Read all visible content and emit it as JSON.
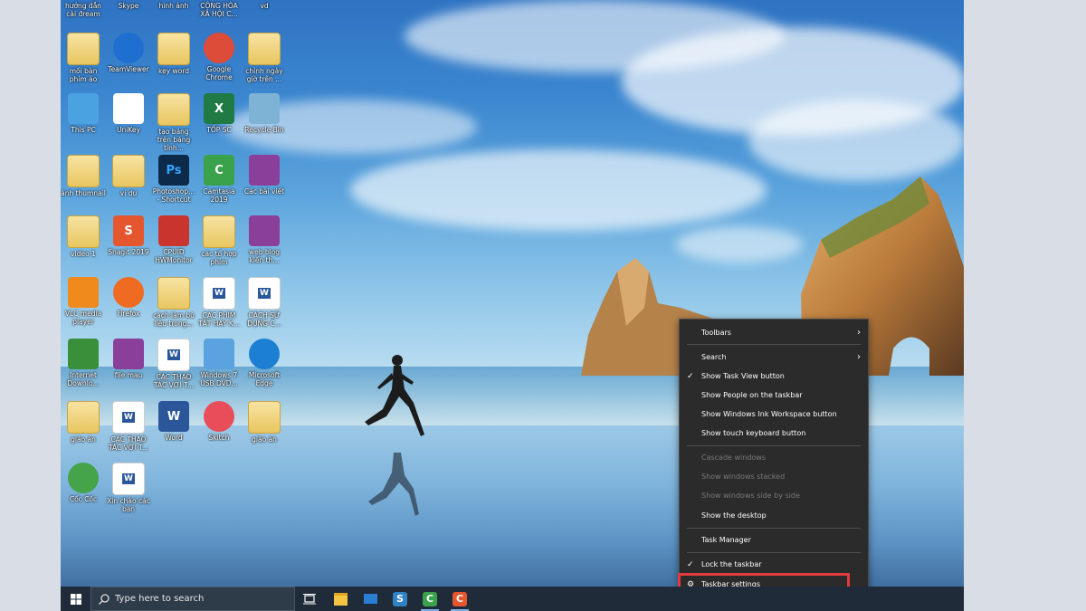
{
  "desktop": {
    "top_labels": [
      "hướng dẫn cài đream",
      "Skype",
      "hình ảnh",
      "CỘNG HÒA XÃ HỘI C...",
      "vd"
    ],
    "icons": [
      {
        "label": "mối bàn phím ảo",
        "icon": "folder-icon"
      },
      {
        "label": "TeamViewer",
        "icon": "teamviewer-icon"
      },
      {
        "label": "key word",
        "icon": "folder-icon"
      },
      {
        "label": "Google Chrome",
        "icon": "chrome-icon"
      },
      {
        "label": "chỉnh ngày giờ trên ...",
        "icon": "folder-icon"
      },
      {
        "label": "This PC",
        "icon": "computer-icon"
      },
      {
        "label": "UniKey",
        "icon": "unikey-icon"
      },
      {
        "label": "tạo bảng trên bảng tính...",
        "icon": "folder-icon"
      },
      {
        "label": "TỐP SC",
        "icon": "excel-icon"
      },
      {
        "label": "Recycle Bin",
        "icon": "recycle-bin-icon"
      },
      {
        "label": "ảnh thumnail",
        "icon": "folder-icon"
      },
      {
        "label": "ví dụ",
        "icon": "folder-icon"
      },
      {
        "label": "Photoshop... - Shortcut",
        "icon": "photoshop-icon"
      },
      {
        "label": "Camtasia 2019",
        "icon": "camtasia-icon"
      },
      {
        "label": "Các bài viết",
        "icon": "winrar-icon"
      },
      {
        "label": "video 1",
        "icon": "folder-icon"
      },
      {
        "label": "Snagit 2019",
        "icon": "snagit-icon"
      },
      {
        "label": "CPUID HWMonitor",
        "icon": "hwmonitor-icon"
      },
      {
        "label": "các tổ hợp phím",
        "icon": "folder-icon"
      },
      {
        "label": "web blog kiến th...",
        "icon": "winrar-icon"
      },
      {
        "label": "VLC media player",
        "icon": "vlc-icon"
      },
      {
        "label": "Firefox",
        "icon": "firefox-icon"
      },
      {
        "label": "cách làm bù liệu trong...",
        "icon": "folder-icon"
      },
      {
        "label": "CÁC PHÍM TẮT HAY K...",
        "icon": "word-icon"
      },
      {
        "label": "CÁCH SỬ DỤNG C...",
        "icon": "word-icon"
      },
      {
        "label": "Internet Downlo...",
        "icon": "idm-icon"
      },
      {
        "label": "file mau",
        "icon": "winrar-icon"
      },
      {
        "label": "CÁC THAO TÁC VỚI T...",
        "icon": "word-icon"
      },
      {
        "label": "Windows 7 USB DVD...",
        "icon": "windows-usb-icon"
      },
      {
        "label": "Microsoft Edge",
        "icon": "edge-icon"
      },
      {
        "label": "giáo án",
        "icon": "folder-icon"
      },
      {
        "label": "CÁC THAO TÁC VỚI T...",
        "icon": "word-icon"
      },
      {
        "label": "Word",
        "icon": "word-app-icon"
      },
      {
        "label": "Skitch",
        "icon": "skitch-icon"
      },
      {
        "label": "giáo án",
        "icon": "folder-icon"
      },
      {
        "label": "Cốc Cốc",
        "icon": "coccoc-icon"
      },
      {
        "label": "Xin chào các bạn",
        "icon": "word-icon"
      }
    ]
  },
  "context_menu": {
    "items": [
      {
        "label": "Toolbars",
        "checked": false,
        "disabled": false,
        "submenu": true
      },
      {
        "label": "Search",
        "checked": false,
        "disabled": false,
        "submenu": true
      },
      {
        "label": "Show Task View button",
        "checked": true,
        "disabled": false
      },
      {
        "label": "Show People on the taskbar",
        "checked": false,
        "disabled": false
      },
      {
        "label": "Show Windows Ink Workspace button",
        "checked": false,
        "disabled": false
      },
      {
        "label": "Show touch keyboard button",
        "checked": false,
        "disabled": false
      },
      {
        "label": "Cascade windows",
        "checked": false,
        "disabled": true
      },
      {
        "label": "Show windows stacked",
        "checked": false,
        "disabled": true
      },
      {
        "label": "Show windows side by side",
        "checked": false,
        "disabled": true
      },
      {
        "label": "Show the desktop",
        "checked": false,
        "disabled": false
      },
      {
        "label": "Task Manager",
        "checked": false,
        "disabled": false
      },
      {
        "label": "Lock the taskbar",
        "checked": true,
        "disabled": false
      },
      {
        "label": "Taskbar settings",
        "checked": false,
        "disabled": false,
        "icon": "gear-icon"
      }
    ]
  },
  "taskbar": {
    "search_placeholder": "Type here to search",
    "pinned": [
      "task-view-icon",
      "file-explorer-icon",
      "mail-icon",
      "snagit-icon",
      "camtasia-icon",
      "snagit-editor-icon"
    ]
  },
  "colors": {
    "highlight": "#e33a3f",
    "menu_bg": "#2b2b2b",
    "taskbar_bg": "#1f2b38"
  }
}
